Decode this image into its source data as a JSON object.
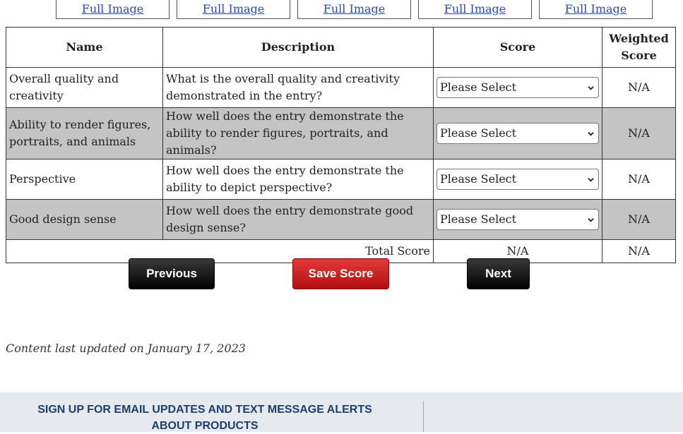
{
  "thumbnails": [
    {
      "link": "Full Image"
    },
    {
      "link": "Full Image"
    },
    {
      "link": "Full Image"
    },
    {
      "link": "Full Image"
    },
    {
      "link": "Full Image"
    }
  ],
  "table": {
    "headers": {
      "name": "Name",
      "description": "Description",
      "score": "Score",
      "weighted": "Weighted Score"
    },
    "rows": [
      {
        "name": "Overall quality and creativity",
        "description": "What is the overall quality and creativity demonstrated in the entry?",
        "select": "Please Select",
        "weighted": "N/A"
      },
      {
        "name": "Ability to render figures, portraits, and animals",
        "description": "How well does the entry demonstrate the ability to render figures, portraits, and animals?",
        "select": "Please Select",
        "weighted": "N/A"
      },
      {
        "name": "Perspective",
        "description": "How well does the entry demonstrate the ability to depict perspective?",
        "select": "Please Select",
        "weighted": "N/A"
      },
      {
        "name": "Good design sense",
        "description": "How well does the entry demonstrate good design sense?",
        "select": "Please Select",
        "weighted": "N/A"
      }
    ],
    "total": {
      "label": "Total Score",
      "score": "N/A",
      "weighted": "N/A"
    }
  },
  "buttons": {
    "previous": "Previous",
    "save": "Save Score",
    "next": "Next"
  },
  "updated": "Content last updated on January 17, 2023",
  "footer": {
    "signup": "SIGN UP FOR EMAIL UPDATES AND TEXT MESSAGE ALERTS ABOUT PRODUCTS"
  },
  "colors": {
    "link": "#2a49b8",
    "alt_row": "#c4c4c4",
    "save_button": "#d42020",
    "footer_bg": "#e6eaee",
    "footer_text": "#1b3f6b"
  },
  "icons": {
    "select_arrow": "chevron-down-icon"
  }
}
